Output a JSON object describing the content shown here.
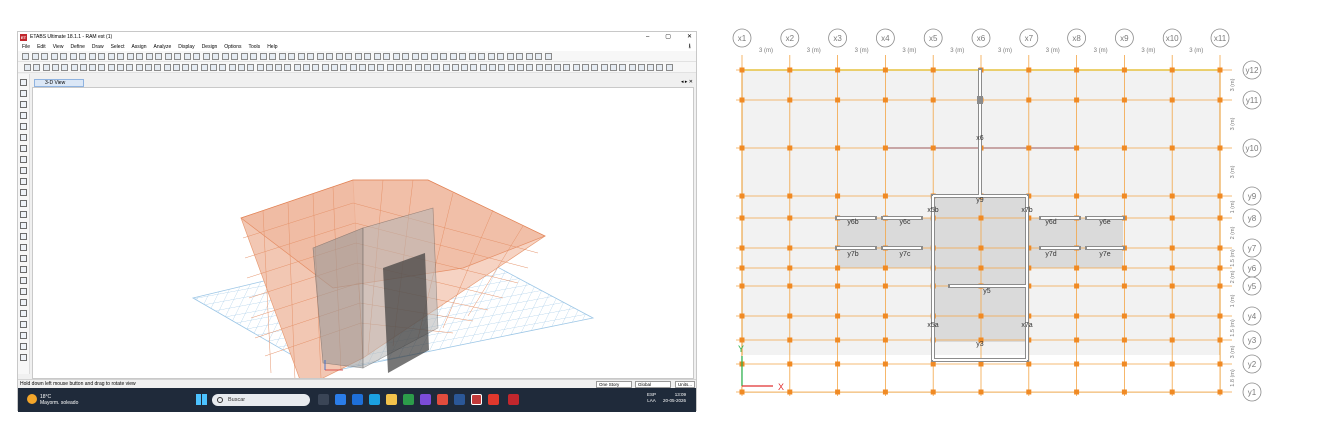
{
  "window": {
    "title": "ETABS Ultimate 18.1.1 - RAM est (1)",
    "app_icon": "ET",
    "minimize": "–",
    "maximize": "▢",
    "close": "✕",
    "download_icon": "⭳"
  },
  "menu": [
    "File",
    "Edit",
    "View",
    "Define",
    "Draw",
    "Select",
    "Assign",
    "Analyze",
    "Display",
    "Design",
    "Options",
    "Tools",
    "Help"
  ],
  "view_tab": "3-D View",
  "view_controls": "◂ ▸ ✕",
  "status": {
    "message": "Hold down left mouse button and drag to rotate view",
    "story_select": "One Story",
    "coord_select": "Global",
    "units_button": "Units..."
  },
  "taskbar": {
    "temperature": "18°C",
    "weather": "Mayorm. soleado",
    "search_placeholder": "Buscar",
    "lang": "ESP",
    "layout": "LAA",
    "time": "13:09",
    "date": "20-05-2026"
  },
  "plan": {
    "x_grids": [
      "x1",
      "x2",
      "x3",
      "x4",
      "x5",
      "x6",
      "x7",
      "x8",
      "x9",
      "x10",
      "x11"
    ],
    "x_spacing_label": "3 (m)",
    "y_grids": [
      "y12",
      "y11",
      "y10",
      "y9",
      "y8",
      "y7",
      "y6",
      "y5",
      "y4",
      "y3",
      "y2",
      "y1"
    ],
    "y_dims": [
      "3 (m)",
      "3 (m)",
      "3 (m)",
      "1 (m)",
      "2 (m)",
      "1.5 (m)",
      "2 (m)",
      "1 (m)",
      "1.5 (m)",
      "3 (m)",
      "1.8 (m)"
    ],
    "wall_labels": [
      "x6",
      "y9",
      "x5b",
      "x7b",
      "y6b",
      "y6c",
      "y6d",
      "y6e",
      "y7b",
      "y7c",
      "y7d",
      "y7e",
      "y5",
      "x5a",
      "x7a",
      "y3"
    ],
    "axis_x": "X",
    "axis_y": "Y",
    "colors": {
      "grid": "#f3a546",
      "node": "#f08a24",
      "beam": "#e8c84a",
      "wall_fill": "#d6d6d6"
    }
  }
}
